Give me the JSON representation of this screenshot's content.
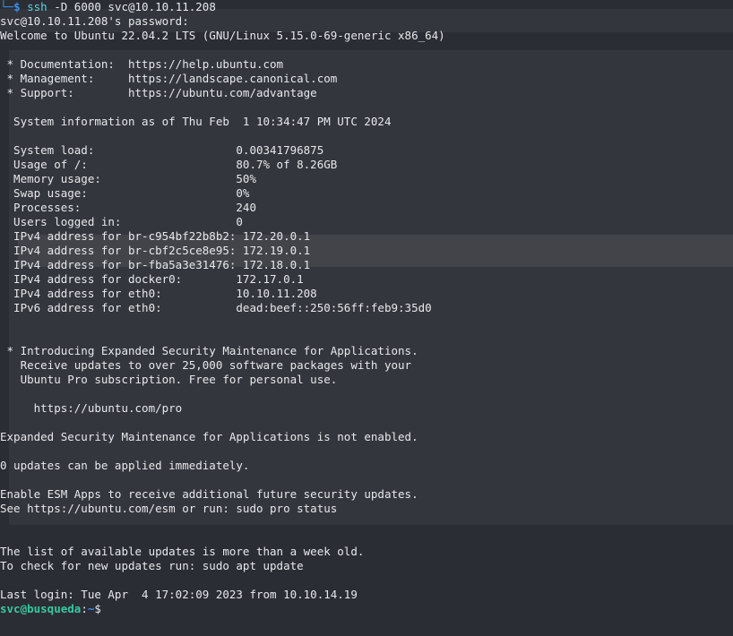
{
  "command_line": {
    "corner": "└─",
    "prompt": "$",
    "command": "ssh",
    "args": " -D 6000 svc@10.10.11.208"
  },
  "output_lines": [
    "svc@10.10.11.208's password:",
    "Welcome to Ubuntu 22.04.2 LTS (GNU/Linux 5.15.0-69-generic x86_64)",
    "",
    " * Documentation:  https://help.ubuntu.com",
    " * Management:     https://landscape.canonical.com",
    " * Support:        https://ubuntu.com/advantage",
    "",
    "  System information as of Thu Feb  1 10:34:47 PM UTC 2024",
    "",
    "  System load:                     0.00341796875",
    "  Usage of /:                      80.7% of 8.26GB",
    "  Memory usage:                    50%",
    "  Swap usage:                      0%",
    "  Processes:                       240",
    "  Users logged in:                 0",
    "  IPv4 address for br-c954bf22b8b2: 172.20.0.1",
    "  IPv4 address for br-cbf2c5ce8e95: 172.19.0.1",
    "  IPv4 address for br-fba5a3e31476: 172.18.0.1",
    "  IPv4 address for docker0:        172.17.0.1",
    "  IPv4 address for eth0:           10.10.11.208",
    "  IPv6 address for eth0:           dead:beef::250:56ff:feb9:35d0",
    "",
    "",
    " * Introducing Expanded Security Maintenance for Applications.",
    "   Receive updates to over 25,000 software packages with your",
    "   Ubuntu Pro subscription. Free for personal use.",
    "",
    "     https://ubuntu.com/pro",
    "",
    "Expanded Security Maintenance for Applications is not enabled.",
    "",
    "0 updates can be applied immediately.",
    "",
    "Enable ESM Apps to receive additional future security updates.",
    "See https://ubuntu.com/esm or run: sudo pro status",
    "",
    "",
    "The list of available updates is more than a week old.",
    "To check for new updates run: sudo apt update",
    "",
    "Last login: Tue Apr  4 17:02:09 2023 from 10.10.14.19"
  ],
  "final_prompt": {
    "user_host": "svc@busqueda",
    "separator": ":",
    "path": "~",
    "symbol": "$"
  },
  "colors": {
    "background": "#2b2d35",
    "text": "#e8e8ea",
    "prompt_blue": "#3e8ee8",
    "user_host_green": "#35c9a0",
    "command_cyan": "#5fd3e0"
  }
}
